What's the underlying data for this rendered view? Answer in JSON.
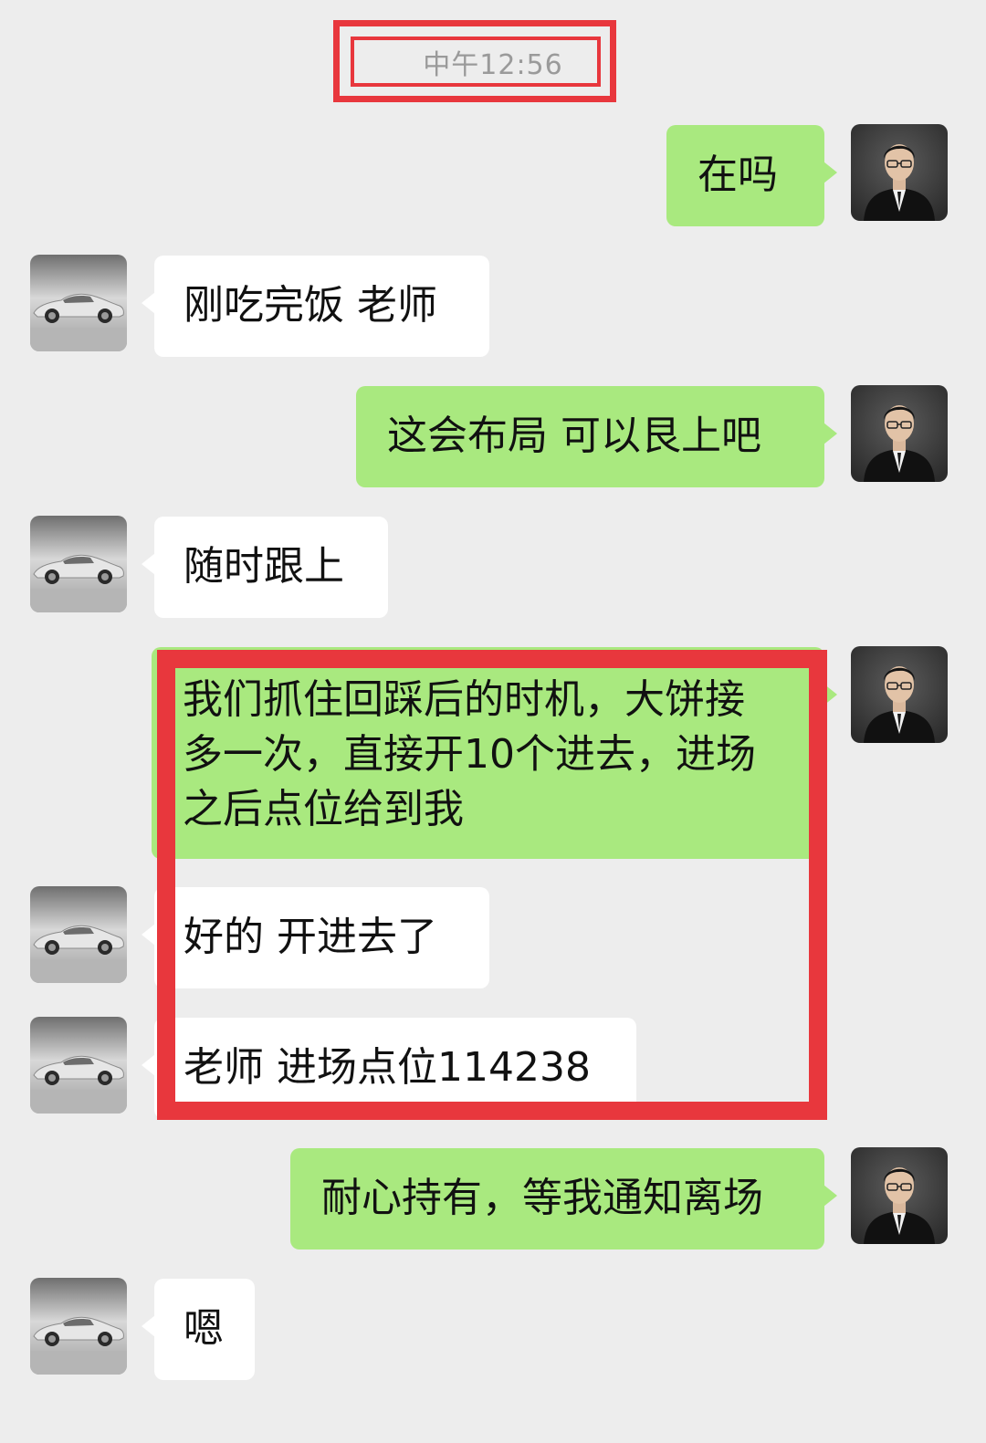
{
  "timestamp": "中午12:56",
  "colors": {
    "me_bubble": "#a9e97f",
    "them_bubble": "#ffffff",
    "highlight": "#e8373d",
    "background": "#ededed"
  },
  "icons": {
    "me_avatar": "man-in-suit-avatar",
    "them_avatar": "sports-car-avatar"
  },
  "messages": [
    {
      "sender": "me",
      "text": "在吗"
    },
    {
      "sender": "them",
      "text": "刚吃完饭 老师"
    },
    {
      "sender": "me",
      "text": "这会布局 可以艮上吧"
    },
    {
      "sender": "them",
      "text": "随时跟上"
    },
    {
      "sender": "me",
      "lines": [
        "我们抓住回踩后的时机，大饼接",
        "多一次，直接开10个进去，进场",
        "之后点位给到我"
      ]
    },
    {
      "sender": "them",
      "text": "好的 开进去了"
    },
    {
      "sender": "them",
      "text": "老师 进场点位114238"
    },
    {
      "sender": "me",
      "text": "耐心持有，等我通知离场"
    },
    {
      "sender": "them",
      "text": "嗯"
    }
  ]
}
